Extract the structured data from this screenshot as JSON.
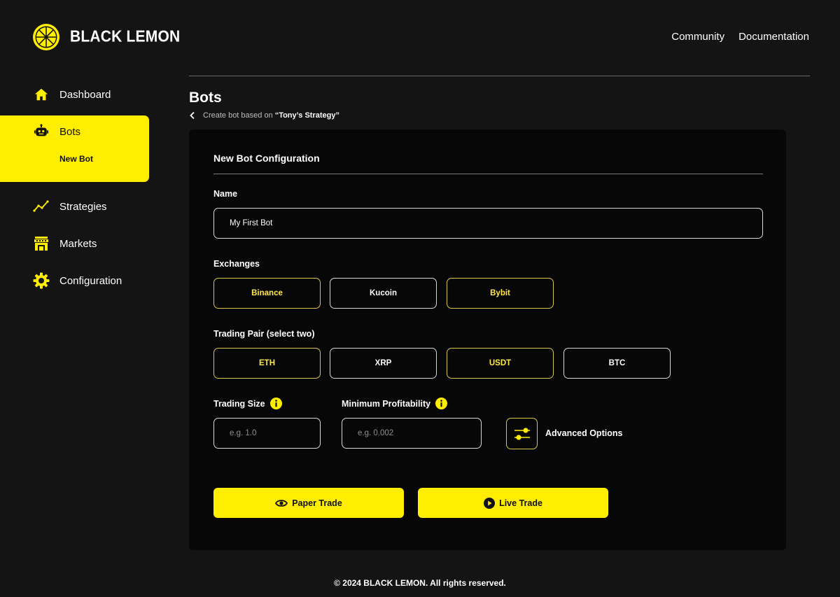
{
  "brand": {
    "name": "BLACK LEMON",
    "accent": "#ffee00",
    "logo_icon": "lemon-slice-icon"
  },
  "topnav": {
    "items": [
      "Community",
      "Documentation"
    ]
  },
  "sidebar": {
    "items": [
      {
        "label": "Dashboard",
        "icon": "home-icon"
      },
      {
        "label": "Bots",
        "icon": "robot-icon",
        "active": true,
        "sub": "New Bot"
      },
      {
        "label": "Strategies",
        "icon": "trend-line-icon"
      },
      {
        "label": "Markets",
        "icon": "market-store-icon"
      },
      {
        "label": "Configuration",
        "icon": "gear-icon"
      }
    ]
  },
  "header": {
    "title": "Bots",
    "breadcrumb_prefix": "Create bot based on",
    "breadcrumb_strategy": "“Tony’s Strategy”"
  },
  "form": {
    "title": "New Bot Configuration",
    "name_label": "Name",
    "name_value": "My First Bot",
    "exchanges_label": "Exchanges",
    "exchanges": [
      {
        "label": "Binance",
        "selected": true
      },
      {
        "label": "Kucoin",
        "selected": false
      },
      {
        "label": "Bybit",
        "selected": true
      }
    ],
    "pair_label": "Trading Pair (select two)",
    "pairs": [
      {
        "label": "ETH",
        "selected": true
      },
      {
        "label": "XRP",
        "selected": false
      },
      {
        "label": "USDT",
        "selected": true
      },
      {
        "label": "BTC",
        "selected": false
      }
    ],
    "size_label": "Trading Size",
    "size_placeholder": "e.g. 1.0",
    "profit_label": "Minimum Profitability",
    "profit_placeholder": "e.g. 0.002",
    "advanced_label": "Advanced Options",
    "paper_trade": "Paper Trade",
    "live_trade": "Live Trade"
  },
  "footer": {
    "text": "© 2024 BLACK LEMON. All rights reserved."
  }
}
